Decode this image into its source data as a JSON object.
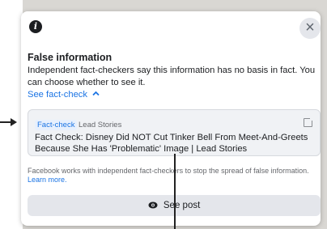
{
  "dialog": {
    "title": "False information",
    "description": "Independent fact-checkers say this information has no basis in fact. You can choose whether to see it.",
    "see_fact_check": "See fact-check",
    "card": {
      "badge": "Fact-check",
      "source": "Lead Stories",
      "headline": "Fact Check: Disney Did NOT Cut Tinker Bell From Meet-And-Greets Because She Has 'Problematic' Image | Lead Stories"
    },
    "footer_text": "Facebook works with independent fact-checkers to stop the spread of false information.",
    "learn_more": "Learn more.",
    "see_post": "See post",
    "close": "×",
    "info_glyph": "i",
    "chevron": "^"
  },
  "icons": [
    "info-icon",
    "close-icon",
    "chevron-up-icon",
    "external-link-icon",
    "eye-icon"
  ],
  "colors": {
    "accent": "#1b74e4",
    "badge_bg": "#e7f0fd",
    "button_bg": "#e4e6eb"
  }
}
